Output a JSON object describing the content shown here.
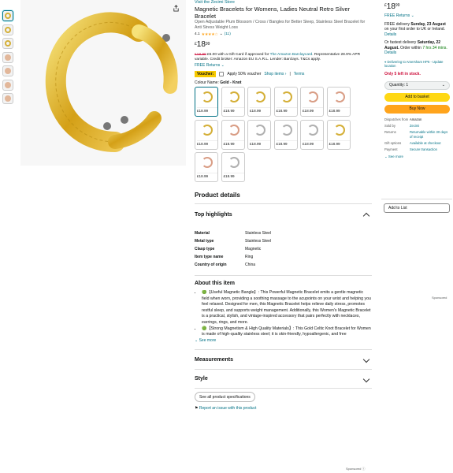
{
  "thumbnails": [
    {
      "name": "thumb-1",
      "type": "ring",
      "selected": true
    },
    {
      "name": "thumb-2",
      "type": "ring",
      "selected": false
    },
    {
      "name": "thumb-3",
      "type": "ring",
      "selected": false
    },
    {
      "name": "thumb-4",
      "type": "person",
      "selected": false
    },
    {
      "name": "thumb-5",
      "type": "person",
      "selected": false
    },
    {
      "name": "thumb-6",
      "type": "person",
      "selected": false
    },
    {
      "name": "thumb-7",
      "type": "person",
      "selected": false
    }
  ],
  "product": {
    "store_link": "Visit the Zecimi Store",
    "title": "Magnetic Bracelets for Womens, Ladies Neutral Retro Silver Bracelet",
    "subtitle": "Open Adjustable Plum Blossom / Cross / Bangles for Better Sleep, Stainless Steel Bracelet for Anti Stress Weight Loss",
    "rating_value": "4.1",
    "stars": "★★★★☆",
    "rating_count": "(11)",
    "price_symbol": "£",
    "price_whole": "18",
    "price_fraction": "99",
    "promo_strike": "£18.99",
    "promo_text": "£5.00 with a Gift Card if approved for",
    "promo_link": "The Amazon Barclaycard",
    "promo_text2": ". Representative 28.9% APR variable. Credit broker: Amazon EU S.A.R.L. Lender: Barclays. T&Cs apply.",
    "returns": "FREE Returns",
    "voucher_badge": "Voucher:",
    "voucher_text": "Apply 50% voucher",
    "voucher_items_link": "Shop items ›",
    "voucher_terms": "Terms",
    "colour_label": "Colour Name:",
    "colour_value": "Gold - Knot",
    "swatches": [
      {
        "price": "£18.99",
        "color": "#d4af37",
        "selected": true
      },
      {
        "price": "£18.99",
        "color": "#d4af37",
        "selected": false
      },
      {
        "price": "£18.99",
        "color": "#d4af37",
        "selected": false
      },
      {
        "price": "£18.99",
        "color": "#d4af37",
        "selected": false
      },
      {
        "price": "£18.99",
        "color": "#d99d85",
        "selected": false
      },
      {
        "price": "£18.99",
        "color": "#d99d85",
        "selected": false
      },
      {
        "price": "£18.99",
        "color": "#d4af37",
        "selected": false
      },
      {
        "price": "£18.99",
        "color": "#d99d85",
        "selected": false
      },
      {
        "price": "£18.99",
        "color": "#b0b0b0",
        "selected": false
      },
      {
        "price": "£18.99",
        "color": "#b0b0b0",
        "selected": false
      },
      {
        "price": "£18.99",
        "color": "#b0b0b0",
        "selected": false
      },
      {
        "price": "£18.99",
        "color": "#d4af37",
        "selected": false
      },
      {
        "price": "£18.99",
        "color": "#d99d85",
        "selected": false
      },
      {
        "price": "£18.99",
        "color": "#b0b0b0",
        "selected": false
      }
    ]
  },
  "details": {
    "heading": "Product details",
    "top_highlights": "Top highlights",
    "specs": [
      {
        "k": "Material",
        "v": "Stainless Steel"
      },
      {
        "k": "Metal type",
        "v": "Stainless Steel"
      },
      {
        "k": "Clasp type",
        "v": "Magnetic"
      },
      {
        "k": "Item type name",
        "v": "Ring"
      },
      {
        "k": "Country of origin",
        "v": "China"
      }
    ],
    "about_heading": "About this item",
    "about": [
      "🟢【Useful Magnetic Bangle】: This Powerful Magnetic Bracelet emits a gentle magnetic field when worn, providing a soothing massage to the acupoints on your wrist and helping you feel relaxed. Designed for men, this Magnetic Bracelet helps relieve daily stress, promotes restful sleep, and supports weight management. Additionally, this Women's Magnetic Bracelet is a practical, stylish, and vintage-inspired accessory that pairs perfectly with necklaces, earrings, rings, and more.",
      "🟢【Strong Magnetism & High Quality Materials】: This Gold Celtic Knot Bracelet for Women is made of high-quality stainless steel; it is skin-friendly, hypoallergenic, and free"
    ],
    "see_more": "See more",
    "measurements": "Measurements",
    "style": "Style",
    "all_specs": "See all product specifications",
    "report": "Report an issue with this product",
    "sponsored": "Sponsored"
  },
  "buybox": {
    "price_symbol": "£",
    "price_whole": "18",
    "price_fraction": "99",
    "returns": "FREE Returns",
    "delivery_pre": "FREE delivery",
    "delivery_day": "Sunday, 23 August",
    "delivery_post": "on your first order to UK or Ireland.",
    "details": "Details",
    "fastest_pre": "Or fastest delivery",
    "fastest_day": "Saturday, 22 August.",
    "fastest_mid": "Order within",
    "fastest_time": "7 hrs 34 mins.",
    "location": "Delivering to Amersham HP6 - Update location",
    "stock": "Only 5 left in stock.",
    "quantity": "Quantity: 1",
    "add_to_basket": "Add to basket",
    "buy_now": "Buy Now",
    "meta": [
      {
        "k": "Dispatches from",
        "v": "Amazon"
      },
      {
        "k": "Sold by",
        "v": "Zecimi"
      },
      {
        "k": "Returns",
        "v": "Returnable within 30 days of receipt"
      },
      {
        "k": "Gift options",
        "v": "Available at checkout"
      },
      {
        "k": "Payment",
        "v": "Secure transaction"
      }
    ],
    "see_more": "See more",
    "add_to_list": "Add to List",
    "sponsored": "Sponsored"
  }
}
